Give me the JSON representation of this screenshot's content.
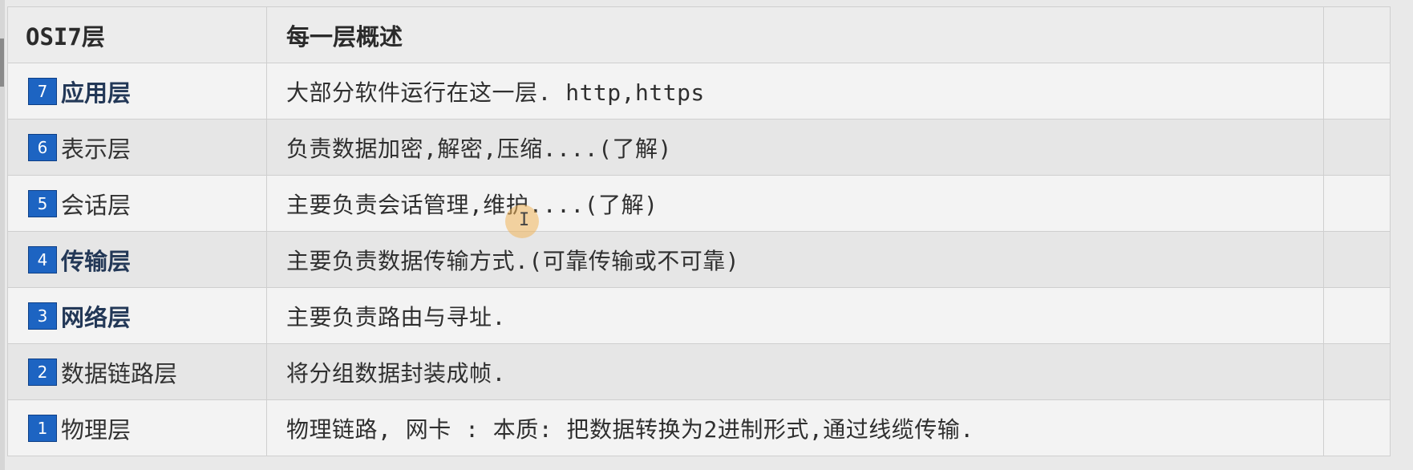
{
  "table": {
    "headers": [
      "OSI7层",
      "每一层概述",
      ""
    ],
    "rows": [
      {
        "num": "7",
        "layer": "应用层",
        "bold": true,
        "desc": "大部分软件运行在这一层.  http,https"
      },
      {
        "num": "6",
        "layer": "表示层",
        "bold": false,
        "desc": "负责数据加密,解密,压缩....(了解)"
      },
      {
        "num": "5",
        "layer": "会话层",
        "bold": false,
        "desc": "主要负责会话管理,维护....(了解)"
      },
      {
        "num": "4",
        "layer": "传输层",
        "bold": true,
        "desc": "主要负责数据传输方式.(可靠传输或不可靠)"
      },
      {
        "num": "3",
        "layer": "网络层",
        "bold": true,
        "desc": "主要负责路由与寻址."
      },
      {
        "num": "2",
        "layer": "数据链路层",
        "bold": false,
        "desc": "将分组数据封装成帧."
      },
      {
        "num": "1",
        "layer": "物理层",
        "bold": false,
        "desc": "物理链路, 网卡 : 本质:  把数据转换为2进制形式,通过线缆传输."
      }
    ]
  },
  "colors": {
    "badge": "#1d64c2",
    "bold_text": "#233857",
    "cursor_highlight": "#f0b45a"
  }
}
